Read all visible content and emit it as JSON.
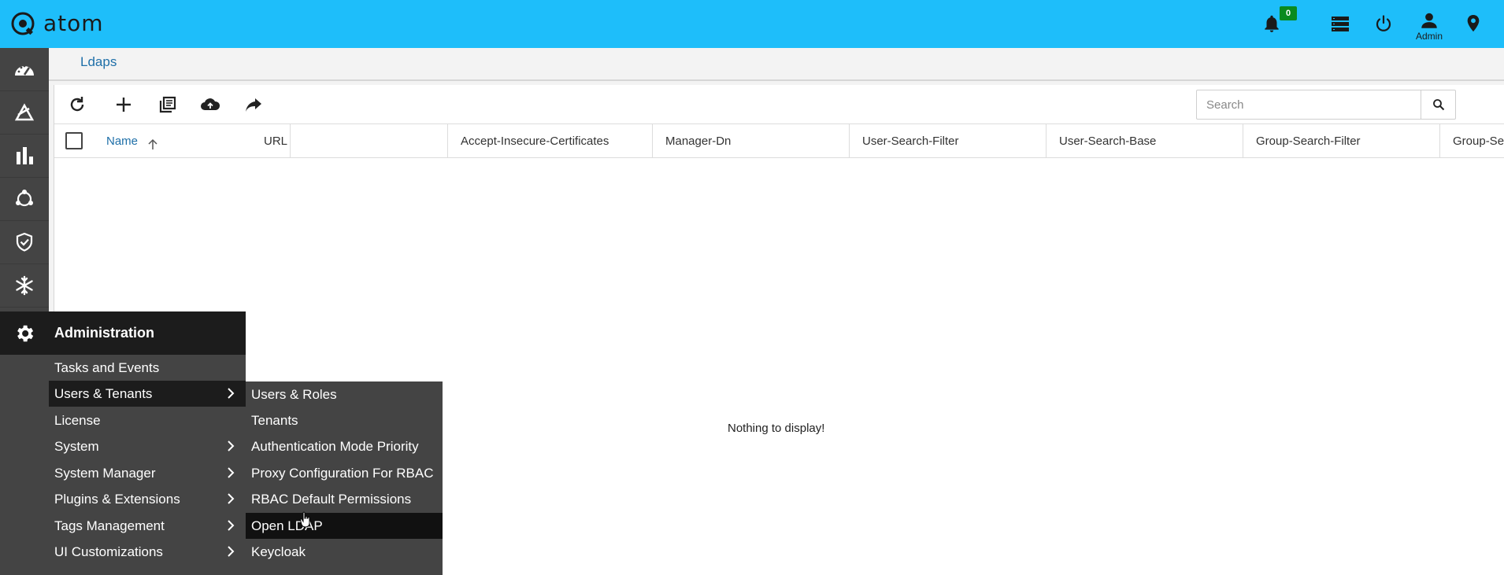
{
  "app": {
    "name": "atom"
  },
  "topbar": {
    "notification_count": "0",
    "user_label": "Admin",
    "icons": [
      "notification-bell-icon",
      "server-list-icon",
      "power-icon",
      "user-icon",
      "location-pin-icon"
    ]
  },
  "leftnav": {
    "icons": [
      "dashboard-icon",
      "devices-icon",
      "analytics-icon",
      "network-icon",
      "security-icon",
      "snowflake-icon",
      "gear-icon"
    ]
  },
  "breadcrumb": {
    "current": "Ldaps"
  },
  "toolbar": {
    "icons": [
      "refresh-icon",
      "add-icon",
      "copy-icon",
      "upload-icon",
      "share-icon"
    ],
    "search_placeholder": "Search"
  },
  "table": {
    "columns": [
      "Name",
      "URL",
      "Accept-Insecure-Certificates",
      "Manager-Dn",
      "User-Search-Filter",
      "User-Search-Base",
      "Group-Search-Filter",
      "Group-Se"
    ],
    "sort_column": "Name",
    "empty_message": "Nothing to display!"
  },
  "admin_menu": {
    "title": "Administration",
    "items": [
      {
        "label": "Tasks and Events",
        "has_submenu": false
      },
      {
        "label": "Users & Tenants",
        "has_submenu": true
      },
      {
        "label": "License",
        "has_submenu": false
      },
      {
        "label": "System",
        "has_submenu": true
      },
      {
        "label": "System Manager",
        "has_submenu": true
      },
      {
        "label": "Plugins & Extensions",
        "has_submenu": true
      },
      {
        "label": "Tags Management",
        "has_submenu": true
      },
      {
        "label": "UI Customizations",
        "has_submenu": true
      }
    ],
    "active_item": "Users & Tenants"
  },
  "users_tenants_submenu": {
    "items": [
      "Users & Roles",
      "Tenants",
      "Authentication Mode Priority",
      "Proxy Configuration For RBAC",
      "RBAC Default Permissions",
      "Open LDAP",
      "Keycloak"
    ],
    "active_item": "Open LDAP"
  },
  "colors": {
    "topbar": "#1ebefa",
    "nav": "#444444",
    "menu_active": "#1c1c1c",
    "badge": "#0a8a1f",
    "link": "#1e6fa8"
  }
}
